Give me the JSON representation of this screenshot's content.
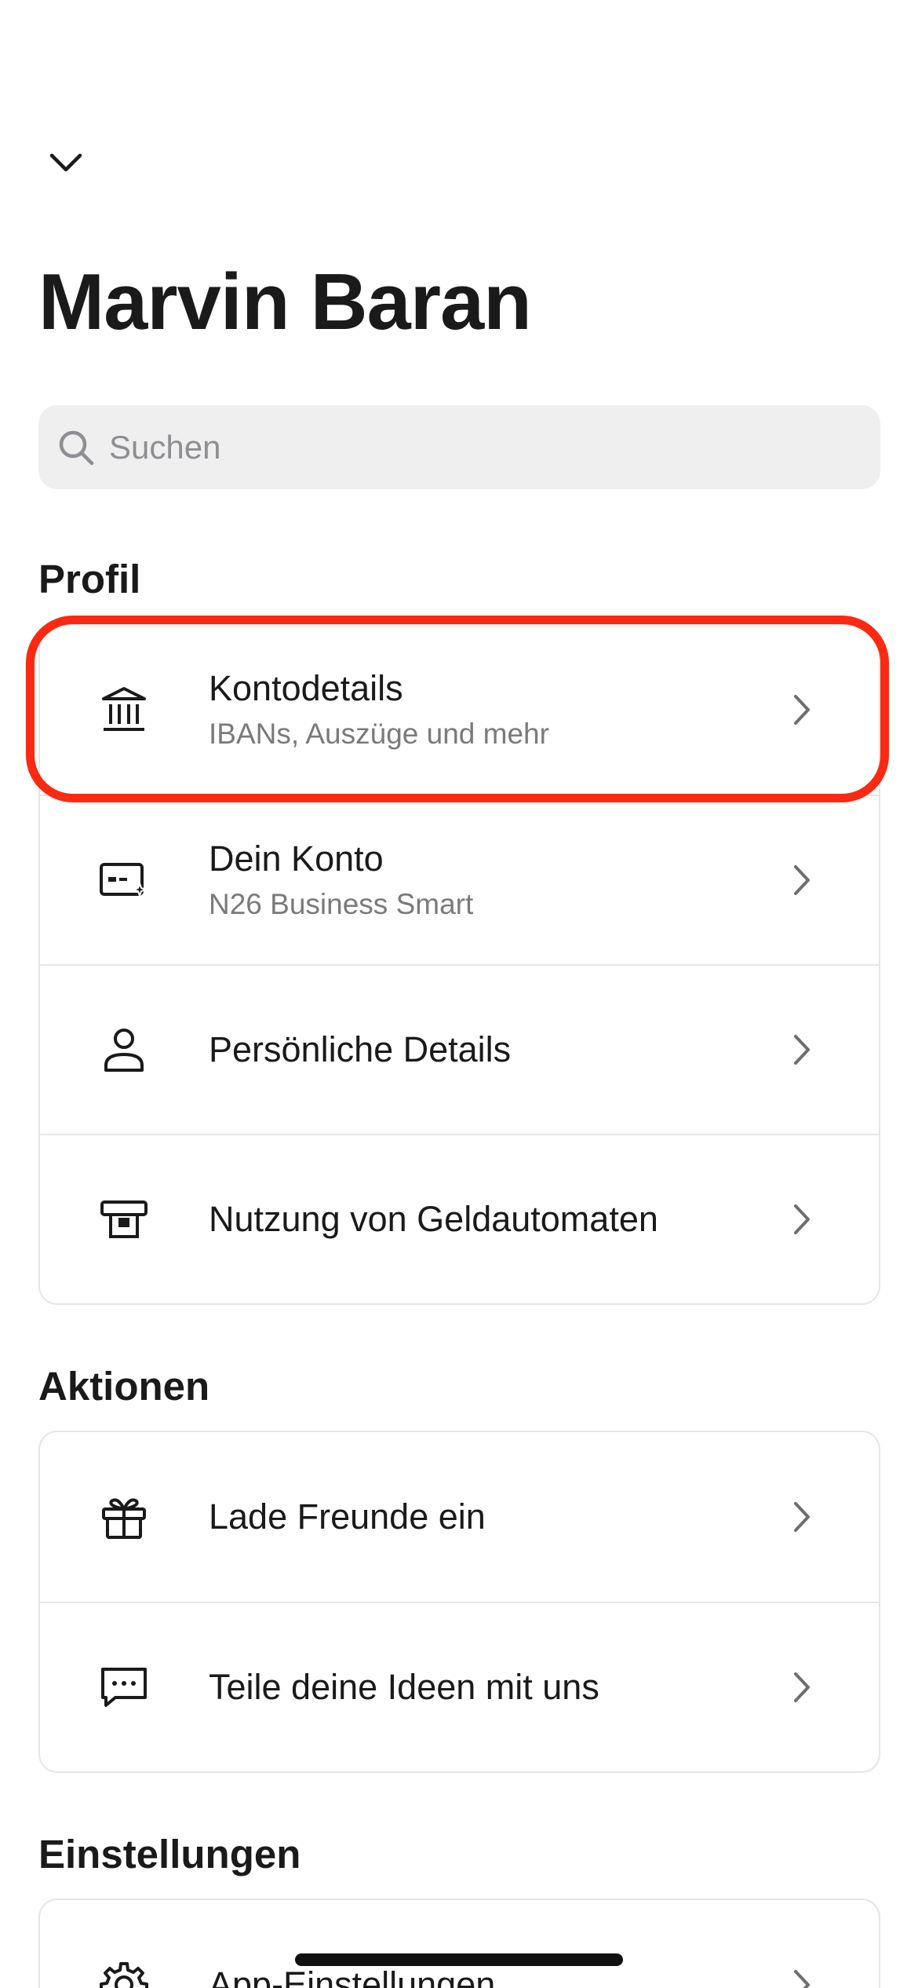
{
  "header": {
    "title": "Marvin Baran"
  },
  "search": {
    "placeholder": "Suchen"
  },
  "sections": {
    "profil": {
      "title": "Profil",
      "items": [
        {
          "title": "Kontodetails",
          "subtitle": "IBANs, Auszüge und mehr",
          "icon": "bank-icon"
        },
        {
          "title": "Dein Konto",
          "subtitle": "N26 Business Smart",
          "icon": "card-sparkle-icon"
        },
        {
          "title": "Persönliche Details",
          "icon": "person-icon"
        },
        {
          "title": "Nutzung von Geldautomaten",
          "icon": "atm-icon"
        }
      ]
    },
    "aktionen": {
      "title": "Aktionen",
      "items": [
        {
          "title": "Lade Freunde ein",
          "icon": "gift-icon"
        },
        {
          "title": "Teile deine Ideen mit uns",
          "icon": "chat-bubble-icon"
        }
      ]
    },
    "einstellungen": {
      "title": "Einstellungen",
      "items": [
        {
          "title": "App-Einstellungen",
          "icon": "gear-icon"
        }
      ]
    }
  },
  "colors": {
    "highlight": "#fa2a12",
    "search_bg": "#efefef",
    "divider": "#e6e6e6"
  }
}
